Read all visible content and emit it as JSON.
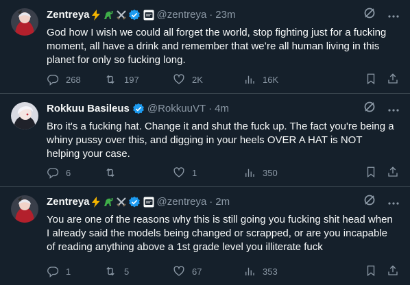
{
  "tweets": [
    {
      "name": "Zentreya",
      "handle": "@zentreya",
      "dot": "·",
      "time": "23m",
      "text": "God how I wish we could all forget the world, stop fighting just for a fucking moment, all have a drink and remember that we’re all human living in this planet for only so fucking long.",
      "replies": "268",
      "retweets": "197",
      "likes": "2K",
      "views": "16K"
    },
    {
      "name": "Rokkuu Basileus",
      "handle": "@RokkuuVT",
      "dot": "·",
      "time": "4m",
      "text": "Bro it's a fucking hat. Change it and shut the fuck up. The fact you're being a whiny pussy over this, and digging in your heels OVER A HAT is NOT helping your case.",
      "replies": "6",
      "retweets": "",
      "likes": "1",
      "views": "350"
    },
    {
      "name": "Zentreya",
      "handle": "@zentreya",
      "dot": "·",
      "time": "2m",
      "text": "You are one of the reasons why this is still going you fucking shit head when I already said the models being changed or scrapped, or are you incapable of reading anything above a 1st grade level you illiterate fuck",
      "replies": "1",
      "retweets": "5",
      "likes": "67",
      "views": "353"
    }
  ],
  "colors": {
    "background": "#15202b",
    "text": "#f7f9f9",
    "muted": "#8b98a5",
    "verified": "#1d9bf0",
    "divider": "#38444d"
  },
  "icons": [
    "reply-icon",
    "retweet-icon",
    "like-icon",
    "views-icon",
    "bookmark-icon",
    "share-icon",
    "grok-icon",
    "more-icon",
    "verified-icon"
  ]
}
